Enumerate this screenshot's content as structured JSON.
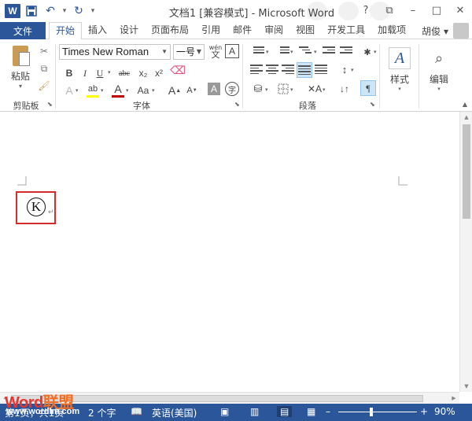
{
  "window": {
    "title": "文档1 [兼容模式] - Microsoft Word",
    "app_icon_letter": "W",
    "controls": [
      "?",
      "⧉",
      "–",
      "□",
      "✕"
    ]
  },
  "tabs": {
    "file": "文件",
    "items": [
      "开始",
      "插入",
      "设计",
      "页面布局",
      "引用",
      "邮件",
      "审阅",
      "视图",
      "开发工具",
      "加载项"
    ],
    "active": "开始",
    "user": "胡俊"
  },
  "ribbon": {
    "clipboard": {
      "paste_label": "粘贴",
      "group_label": "剪贴板"
    },
    "font": {
      "font_name": "Times New Roman",
      "font_size": "一号",
      "wen_label": "wén",
      "group_label": "字体",
      "buttons": {
        "bold": "B",
        "italic": "I",
        "underline": "U",
        "strike": "abc",
        "sub": "x₂",
        "sup": "x²",
        "font_color": "A",
        "case": "Aa",
        "grow": "A",
        "shrink": "A",
        "char_shade": "A",
        "enclose": "字"
      }
    },
    "paragraph": {
      "group_label": "段落"
    },
    "styles": {
      "label": "样式"
    },
    "editing": {
      "label": "编辑"
    }
  },
  "document": {
    "content_char": "K",
    "paragraph_mark": "↵"
  },
  "statusbar": {
    "page": "第1页，共1页",
    "words": "2 个字",
    "language": "英语(美国)",
    "zoom": "90%",
    "zoom_level": 0.9
  },
  "watermark": {
    "brand_a": "Word",
    "brand_b": "联盟",
    "url": "www.wordlm.com"
  },
  "colors": {
    "accent": "#2b579a",
    "highlight": "#d42b2b"
  }
}
